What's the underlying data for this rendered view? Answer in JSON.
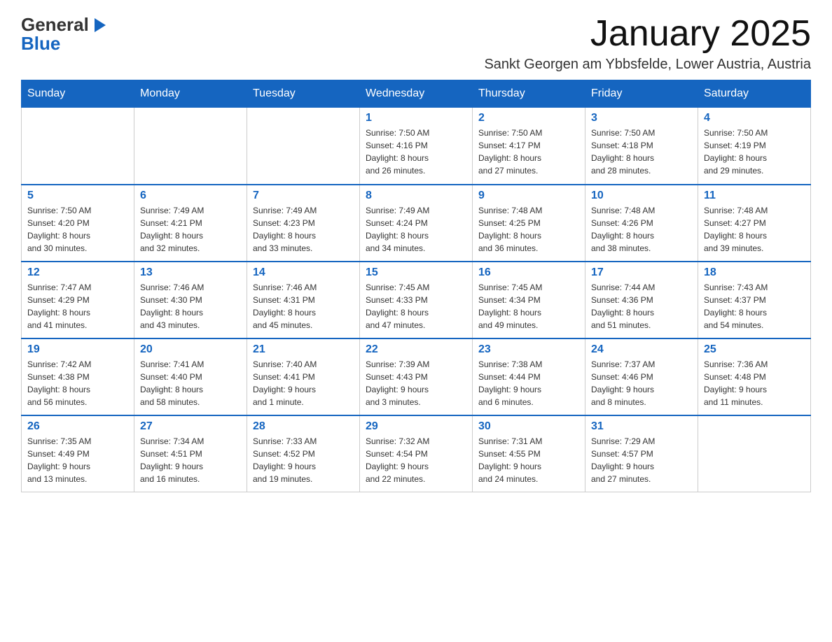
{
  "header": {
    "logo": {
      "general": "General",
      "blue": "Blue",
      "arrow_icon": "▶"
    },
    "title": "January 2025",
    "location": "Sankt Georgen am Ybbsfelde, Lower Austria, Austria"
  },
  "days_of_week": [
    "Sunday",
    "Monday",
    "Tuesday",
    "Wednesday",
    "Thursday",
    "Friday",
    "Saturday"
  ],
  "weeks": [
    {
      "cells": [
        {
          "day": "",
          "info": ""
        },
        {
          "day": "",
          "info": ""
        },
        {
          "day": "",
          "info": ""
        },
        {
          "day": "1",
          "info": "Sunrise: 7:50 AM\nSunset: 4:16 PM\nDaylight: 8 hours\nand 26 minutes."
        },
        {
          "day": "2",
          "info": "Sunrise: 7:50 AM\nSunset: 4:17 PM\nDaylight: 8 hours\nand 27 minutes."
        },
        {
          "day": "3",
          "info": "Sunrise: 7:50 AM\nSunset: 4:18 PM\nDaylight: 8 hours\nand 28 minutes."
        },
        {
          "day": "4",
          "info": "Sunrise: 7:50 AM\nSunset: 4:19 PM\nDaylight: 8 hours\nand 29 minutes."
        }
      ]
    },
    {
      "cells": [
        {
          "day": "5",
          "info": "Sunrise: 7:50 AM\nSunset: 4:20 PM\nDaylight: 8 hours\nand 30 minutes."
        },
        {
          "day": "6",
          "info": "Sunrise: 7:49 AM\nSunset: 4:21 PM\nDaylight: 8 hours\nand 32 minutes."
        },
        {
          "day": "7",
          "info": "Sunrise: 7:49 AM\nSunset: 4:23 PM\nDaylight: 8 hours\nand 33 minutes."
        },
        {
          "day": "8",
          "info": "Sunrise: 7:49 AM\nSunset: 4:24 PM\nDaylight: 8 hours\nand 34 minutes."
        },
        {
          "day": "9",
          "info": "Sunrise: 7:48 AM\nSunset: 4:25 PM\nDaylight: 8 hours\nand 36 minutes."
        },
        {
          "day": "10",
          "info": "Sunrise: 7:48 AM\nSunset: 4:26 PM\nDaylight: 8 hours\nand 38 minutes."
        },
        {
          "day": "11",
          "info": "Sunrise: 7:48 AM\nSunset: 4:27 PM\nDaylight: 8 hours\nand 39 minutes."
        }
      ]
    },
    {
      "cells": [
        {
          "day": "12",
          "info": "Sunrise: 7:47 AM\nSunset: 4:29 PM\nDaylight: 8 hours\nand 41 minutes."
        },
        {
          "day": "13",
          "info": "Sunrise: 7:46 AM\nSunset: 4:30 PM\nDaylight: 8 hours\nand 43 minutes."
        },
        {
          "day": "14",
          "info": "Sunrise: 7:46 AM\nSunset: 4:31 PM\nDaylight: 8 hours\nand 45 minutes."
        },
        {
          "day": "15",
          "info": "Sunrise: 7:45 AM\nSunset: 4:33 PM\nDaylight: 8 hours\nand 47 minutes."
        },
        {
          "day": "16",
          "info": "Sunrise: 7:45 AM\nSunset: 4:34 PM\nDaylight: 8 hours\nand 49 minutes."
        },
        {
          "day": "17",
          "info": "Sunrise: 7:44 AM\nSunset: 4:36 PM\nDaylight: 8 hours\nand 51 minutes."
        },
        {
          "day": "18",
          "info": "Sunrise: 7:43 AM\nSunset: 4:37 PM\nDaylight: 8 hours\nand 54 minutes."
        }
      ]
    },
    {
      "cells": [
        {
          "day": "19",
          "info": "Sunrise: 7:42 AM\nSunset: 4:38 PM\nDaylight: 8 hours\nand 56 minutes."
        },
        {
          "day": "20",
          "info": "Sunrise: 7:41 AM\nSunset: 4:40 PM\nDaylight: 8 hours\nand 58 minutes."
        },
        {
          "day": "21",
          "info": "Sunrise: 7:40 AM\nSunset: 4:41 PM\nDaylight: 9 hours\nand 1 minute."
        },
        {
          "day": "22",
          "info": "Sunrise: 7:39 AM\nSunset: 4:43 PM\nDaylight: 9 hours\nand 3 minutes."
        },
        {
          "day": "23",
          "info": "Sunrise: 7:38 AM\nSunset: 4:44 PM\nDaylight: 9 hours\nand 6 minutes."
        },
        {
          "day": "24",
          "info": "Sunrise: 7:37 AM\nSunset: 4:46 PM\nDaylight: 9 hours\nand 8 minutes."
        },
        {
          "day": "25",
          "info": "Sunrise: 7:36 AM\nSunset: 4:48 PM\nDaylight: 9 hours\nand 11 minutes."
        }
      ]
    },
    {
      "cells": [
        {
          "day": "26",
          "info": "Sunrise: 7:35 AM\nSunset: 4:49 PM\nDaylight: 9 hours\nand 13 minutes."
        },
        {
          "day": "27",
          "info": "Sunrise: 7:34 AM\nSunset: 4:51 PM\nDaylight: 9 hours\nand 16 minutes."
        },
        {
          "day": "28",
          "info": "Sunrise: 7:33 AM\nSunset: 4:52 PM\nDaylight: 9 hours\nand 19 minutes."
        },
        {
          "day": "29",
          "info": "Sunrise: 7:32 AM\nSunset: 4:54 PM\nDaylight: 9 hours\nand 22 minutes."
        },
        {
          "day": "30",
          "info": "Sunrise: 7:31 AM\nSunset: 4:55 PM\nDaylight: 9 hours\nand 24 minutes."
        },
        {
          "day": "31",
          "info": "Sunrise: 7:29 AM\nSunset: 4:57 PM\nDaylight: 9 hours\nand 27 minutes."
        },
        {
          "day": "",
          "info": ""
        }
      ]
    }
  ]
}
